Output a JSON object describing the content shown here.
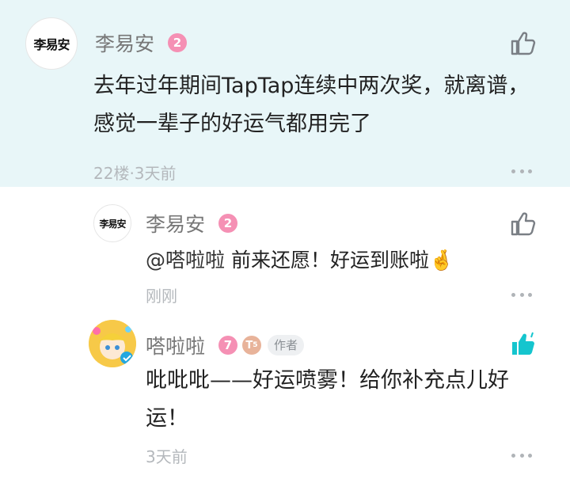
{
  "comments": [
    {
      "avatar_text": "李易安",
      "author": "李易安",
      "level": "2",
      "level_color": "#f590b4",
      "text_lines": [
        "去年过年期间TapTap连续中两次奖，就离谱，",
        "感觉一辈子的好运气都用完了"
      ],
      "meta": "22楼·3天前",
      "like_icon": "thumbs-up-outline-icon",
      "more_icon": "more-dots-icon"
    }
  ],
  "replies": [
    {
      "avatar_text": "李易安",
      "author": "李易安",
      "level": "2",
      "level_color": "#f590b4",
      "mention": "@嗒啦啦",
      "text": "前来还愿！好运到账啦🤞",
      "meta": "刚刚",
      "like_icon": "thumbs-up-outline-icon"
    },
    {
      "author": "嗒啦啦",
      "level": "7",
      "level_color": "#f590b4",
      "t_badge": "T",
      "t_badge_sub": "5",
      "t_badge_color": "#e8b39a",
      "author_tag": "作者",
      "text_lines": [
        "吡吡吡——好运喷雾！给你补充点儿好",
        "运！"
      ],
      "meta": "3天前",
      "like_icon": "thumbs-up-filled-icon",
      "like_color": "#15c5ce"
    }
  ]
}
